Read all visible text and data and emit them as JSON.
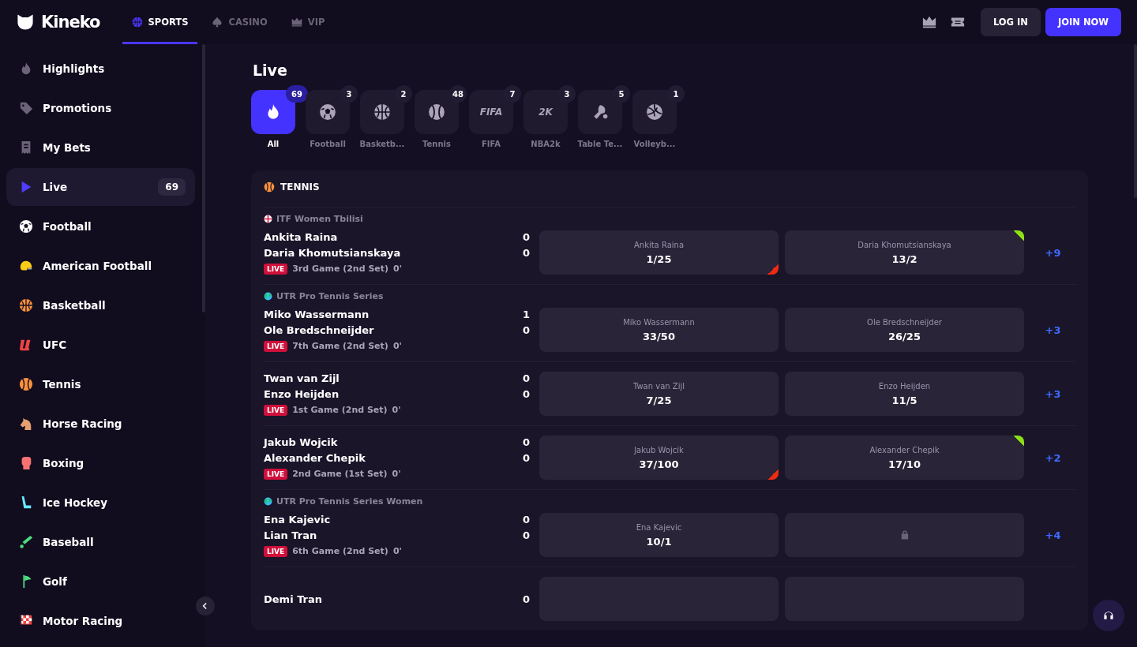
{
  "header": {
    "logo": "Kineko",
    "nav": [
      {
        "label": "SPORTS",
        "kind": "basketball",
        "selected": true
      },
      {
        "label": "CASINO",
        "kind": "spade",
        "selected": false
      },
      {
        "label": "VIP",
        "kind": "crown",
        "selected": false
      }
    ],
    "tools": [
      {
        "kind": "crown"
      },
      {
        "kind": "ticket"
      }
    ],
    "actions": [
      {
        "label": "LOG IN",
        "kind": "secondary"
      },
      {
        "label": "JOIN NOW",
        "kind": "primary"
      }
    ]
  },
  "sidebar": {
    "items": [
      {
        "label": "Highlights",
        "kind": "flame",
        "selected": false
      },
      {
        "label": "Promotions",
        "kind": "tag",
        "selected": false
      },
      {
        "label": "My Bets",
        "kind": "slip",
        "selected": false
      },
      {
        "label": "Live",
        "kind": "play",
        "selected": true,
        "badge": "69"
      },
      {
        "label": "Football",
        "kind": "soccer",
        "selected": false
      },
      {
        "label": "American Football",
        "kind": "helmet",
        "selected": false
      },
      {
        "label": "Basketball",
        "kind": "basketball",
        "selected": false
      },
      {
        "label": "UFC",
        "kind": "stripes",
        "selected": false
      },
      {
        "label": "Tennis",
        "kind": "tennis",
        "selected": false
      },
      {
        "label": "Horse Racing",
        "kind": "horse",
        "selected": false
      },
      {
        "label": "Boxing",
        "kind": "glove",
        "selected": false
      },
      {
        "label": "Ice Hockey",
        "kind": "hockey",
        "selected": false
      },
      {
        "label": "Baseball",
        "kind": "bat",
        "selected": false
      },
      {
        "label": "Golf",
        "kind": "golf",
        "selected": false
      },
      {
        "label": "Motor Racing",
        "kind": "checker",
        "selected": false
      }
    ]
  },
  "main": {
    "title": "Live",
    "filters": [
      {
        "label": "All",
        "count": "69",
        "kind": "flame",
        "selected": true
      },
      {
        "label": "Football",
        "count": "3",
        "kind": "soccer",
        "selected": false
      },
      {
        "label": "Basketb...",
        "count": "2",
        "kind": "basketball",
        "selected": false
      },
      {
        "label": "Tennis",
        "count": "48",
        "kind": "tennis",
        "selected": false
      },
      {
        "label": "FIFA",
        "count": "7",
        "kind": "text",
        "icon_text": "FIFA",
        "selected": false
      },
      {
        "label": "NBA2k",
        "count": "3",
        "kind": "text",
        "icon_text": "2K",
        "selected": false
      },
      {
        "label": "Table Te...",
        "count": "5",
        "kind": "paddle",
        "selected": false
      },
      {
        "label": "Volleyb...",
        "count": "1",
        "kind": "volleyball",
        "selected": false
      }
    ],
    "section": {
      "title": "TENNIS",
      "matches": [
        {
          "league": {
            "name": "ITF Women Tbilisi",
            "kind": "flag"
          },
          "home": "Ankita Raina",
          "away": "Daria Khomutsianskaya",
          "home_score": "0",
          "away_score": "0",
          "live": "LIVE",
          "status": "3rd Game (2nd Set)",
          "time": "0'",
          "odds": [
            {
              "kind": "price",
              "label": "Ankita Raina",
              "price": "1/25",
              "rising": false,
              "falling": true
            },
            {
              "kind": "price",
              "label": "Daria Khomutsianskaya",
              "price": "13/2",
              "rising": true,
              "falling": false
            }
          ],
          "more": "+9"
        },
        {
          "league": {
            "name": "UTR Pro Tennis Series",
            "kind": "globe"
          },
          "home": "Miko Wassermann",
          "away": "Ole Bredschneijder",
          "home_score": "1",
          "away_score": "0",
          "live": "LIVE",
          "status": "7th Game (2nd Set)",
          "time": "0'",
          "odds": [
            {
              "kind": "price",
              "label": "Miko Wassermann",
              "price": "33/50",
              "rising": false,
              "falling": false
            },
            {
              "kind": "price",
              "label": "Ole Bredschneijder",
              "price": "26/25",
              "rising": false,
              "falling": false
            }
          ],
          "more": "+3"
        },
        {
          "home": "Twan van Zijl",
          "away": "Enzo Heijden",
          "home_score": "0",
          "away_score": "0",
          "live": "LIVE",
          "status": "1st Game (2nd Set)",
          "time": "0'",
          "odds": [
            {
              "kind": "price",
              "label": "Twan van Zijl",
              "price": "7/25",
              "rising": false,
              "falling": false
            },
            {
              "kind": "price",
              "label": "Enzo Heijden",
              "price": "11/5",
              "rising": false,
              "falling": false
            }
          ],
          "more": "+3"
        },
        {
          "home": "Jakub Wojcik",
          "away": "Alexander Chepik",
          "home_score": "0",
          "away_score": "0",
          "live": "LIVE",
          "status": "2nd Game (1st Set)",
          "time": "0'",
          "odds": [
            {
              "kind": "price",
              "label": "Jakub Wojcik",
              "price": "37/100",
              "rising": false,
              "falling": true
            },
            {
              "kind": "price",
              "label": "Alexander Chepik",
              "price": "17/10",
              "rising": true,
              "falling": false
            }
          ],
          "more": "+2"
        },
        {
          "league": {
            "name": "UTR Pro Tennis Series Women",
            "kind": "globe"
          },
          "home": "Ena Kajevic",
          "away": "Lian Tran",
          "home_score": "0",
          "away_score": "0",
          "live": "LIVE",
          "status": "6th Game (2nd Set)",
          "time": "0'",
          "odds": [
            {
              "kind": "price",
              "label": "Ena Kajevic",
              "price": "10/1",
              "rising": false,
              "falling": false
            },
            {
              "kind": "locked"
            }
          ],
          "more": "+4"
        },
        {
          "home": "Demi Tran",
          "home_score": "0",
          "odds": [
            {
              "kind": "blank"
            },
            {
              "kind": "blank"
            }
          ]
        }
      ]
    }
  }
}
